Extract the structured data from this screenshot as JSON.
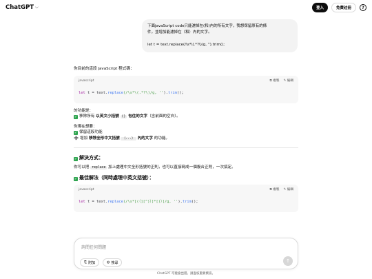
{
  "header": {
    "brand": "ChatGPT",
    "login_label": "登入",
    "signup_label": "免費註冊",
    "help_glyph": "?"
  },
  "user_message": {
    "line1": "下面javaScript code只能濾掉在(和)內的所有文字，我想保留原有的條",
    "line2": "件，並增加能濾掉在（和）內的文字。",
    "line3": "let t = text.replace(/\\s*\\(.*?\\)/g, '').trim();"
  },
  "answer": {
    "intro": "你目前的這段 JavaScript 程式碼：",
    "code1": {
      "lang": "javascript",
      "copy_label": "複製",
      "edit_label": "編輯",
      "tok_let": "let",
      "tok_mid": " t = text.",
      "tok_replace": "replace",
      "tok_regex": "(/\\s*\\(.*?\\)/g, ",
      "tok_str": "''",
      "tok_close": ").",
      "tok_trim": "trim",
      "tok_end": "();"
    },
    "func_title": "的功能是：",
    "func_item_pre": "移除所有 ",
    "func_item_bold1": "以英文小括號",
    "func_item_code": "()",
    "func_item_bold2": "包住的文字",
    "func_item_post": "（含前面的空白）。",
    "want_title": "你現在想要：",
    "want_item1": "保留這段功能",
    "want_item2_pre": "增加 ",
    "want_item2_bold1": "移除全形中文括號",
    "want_item2_code": "（...）",
    "want_item2_bold2": "內的文字",
    "want_item2_post": " 的功能。",
    "solution_title": "解決方式：",
    "solution_pre": "你可以把 ",
    "solution_code": "replace",
    "solution_post": " 加上處理中文全形括號的正則，也可以直接寫成一個複合正則，一次搞定。",
    "best_title": "最佳解法（同時處理中英文括號）：",
    "code2": {
      "lang": "javascript",
      "copy_label": "複製",
      "edit_label": "編輯",
      "tok_let": "let",
      "tok_mid": " t = text.",
      "tok_replace": "replace",
      "tok_regex": "(/\\s*[(（][^)）]*[)）]/g, ",
      "tok_str": "''",
      "tok_close": ").",
      "tok_trim": "trim",
      "tok_end": "();"
    }
  },
  "composer": {
    "placeholder": "詢問任何問題",
    "attach_label": "附加",
    "search_label": "搜尋",
    "send_glyph": "↑"
  },
  "footer": {
    "disclaimer": "ChatGPT 可能會出錯。請查核重要資訊。"
  },
  "colors": {
    "accent_dark": "#0d0d0d",
    "bubble_bg": "#f3f3f3",
    "code_bg": "#f7f7f7",
    "check_green": "#2ea44f"
  }
}
